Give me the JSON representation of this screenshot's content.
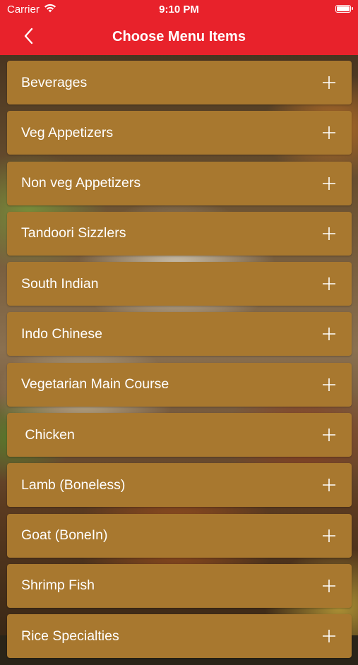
{
  "status_bar": {
    "carrier": "Carrier",
    "time": "9:10 PM"
  },
  "nav": {
    "title": "Choose Menu Items",
    "back_icon": "chevron-left-icon"
  },
  "menu": {
    "items": [
      {
        "label": "Beverages"
      },
      {
        "label": "Veg Appetizers"
      },
      {
        "label": "Non veg Appetizers"
      },
      {
        "label": "Tandoori Sizzlers"
      },
      {
        "label": "South Indian"
      },
      {
        "label": "Indo Chinese"
      },
      {
        "label": "Vegetarian Main Course"
      },
      {
        "label": " Chicken"
      },
      {
        "label": "Lamb (Boneless)"
      },
      {
        "label": "Goat (BoneIn)"
      },
      {
        "label": "Shrimp Fish"
      },
      {
        "label": "Rice Specialties"
      }
    ],
    "expand_icon": "plus-icon"
  },
  "colors": {
    "header": "#e8222b",
    "item_background": "#a8782f",
    "text": "#ffffff"
  }
}
